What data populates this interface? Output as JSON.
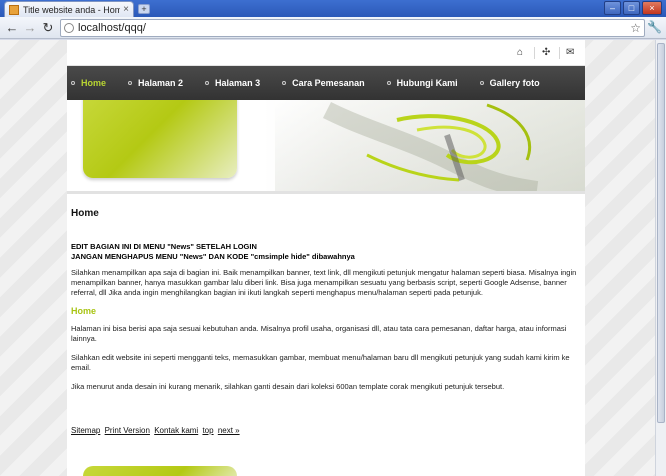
{
  "browser": {
    "tab_title": "Title website anda - Home",
    "url": "localhost/qqq/"
  },
  "icons": {
    "back": "arrow-left-icon",
    "forward": "arrow-right-icon",
    "reload": "reload-icon",
    "star": "star-icon",
    "wrench": "wrench-icon",
    "home": "home-icon",
    "sitemap": "sitemap-icon",
    "mail": "mail-icon"
  },
  "nav": {
    "items": [
      "Home",
      "Halaman 2",
      "Halaman 3",
      "Cara Pemesanan",
      "Hubungi Kami",
      "Gallery foto"
    ],
    "active_color": "#b8d432"
  },
  "content": {
    "title": "Home",
    "notice_line1": "EDIT BAGIAN INI DI MENU \"News\" SETELAH LOGIN",
    "notice_line2": "JANGAN MENGHAPUS MENU \"News\" DAN KODE \"cmsimple hide\" dibawahnya",
    "para1": "Silahkan menampilkan apa saja di bagian ini. Baik menampilkan banner, text link, dll mengikuti petunjuk mengatur halaman seperti biasa. Misalnya ingin menampilkan banner, hanya masukkan gambar lalu diberi link. Bisa juga menampilkan sesuatu yang berbasis script, seperti Google Adsense, banner referral, dll Jika anda ingin menghilangkan bagian ini ikuti langkah seperti menghapus menu/halaman seperti pada petunjuk.",
    "subtitle": "Home",
    "para2": "Halaman ini bisa berisi apa saja sesuai kebutuhan anda. Misalnya profil usaha, organisasi dll, atau tata cara pemesanan, daftar harga, atau informasi lainnya.",
    "para3": "Silahkan edit website ini seperti mengganti teks, memasukkan gambar, membuat menu/halaman baru dll mengikuti petunjuk yang sudah kami kirim ke email.",
    "para4": "Jika menurut anda desain ini kurang menarik, silahkan ganti desain dari koleksi 600an template corak mengikuti petunjuk tersebut."
  },
  "footer": {
    "links": [
      "Sitemap",
      "Print Version",
      "Kontak kami",
      "top",
      "next »"
    ]
  },
  "colors": {
    "accent_green": "#b4c914",
    "navbar": "#3a3a3a"
  }
}
